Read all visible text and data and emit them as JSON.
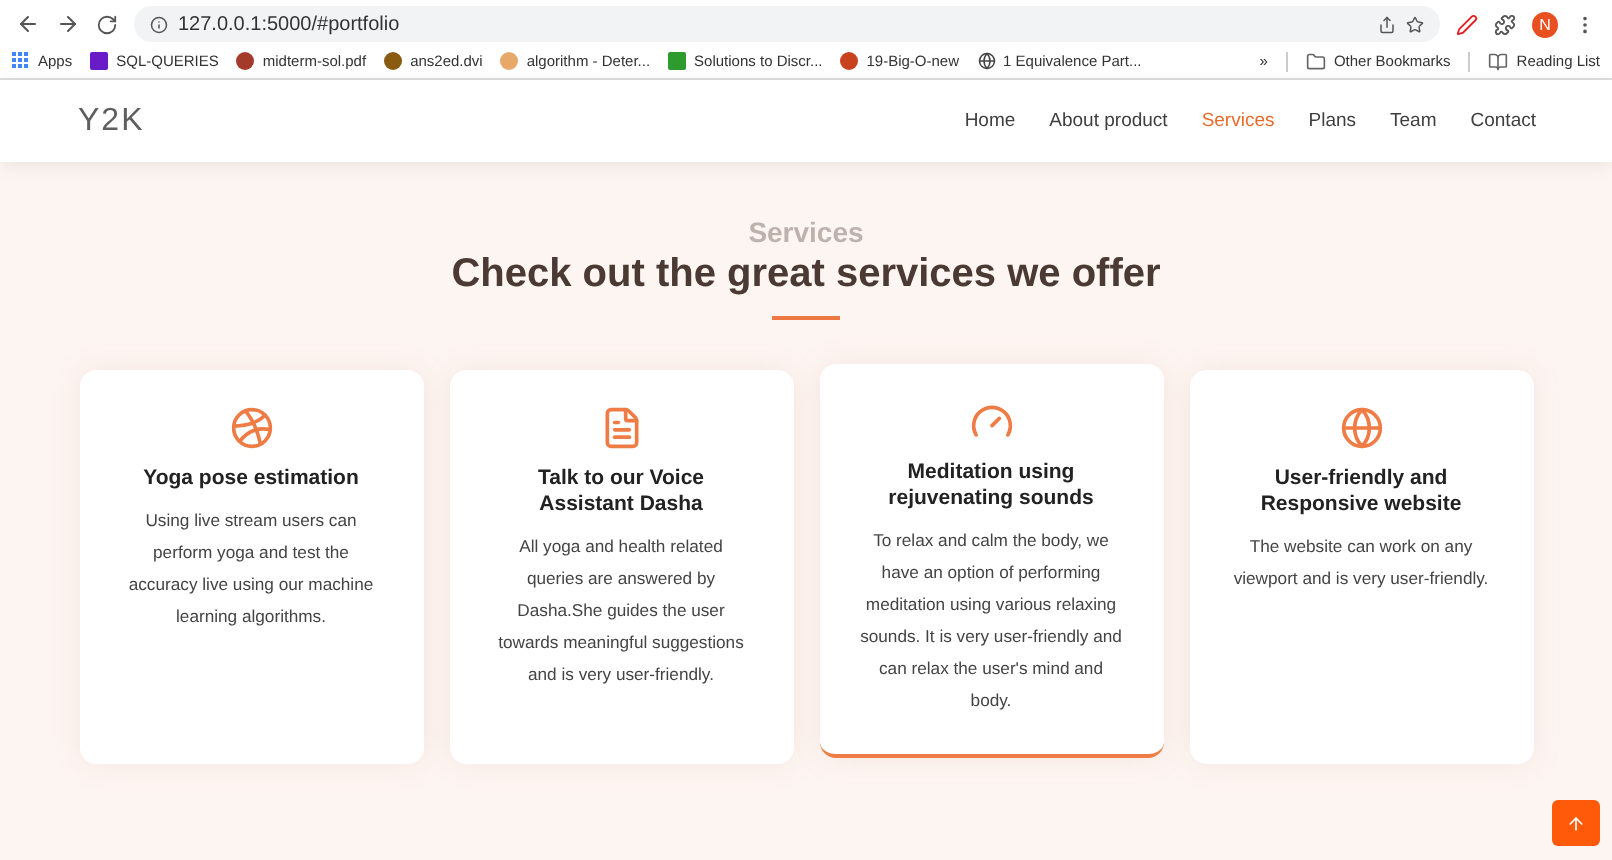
{
  "browser": {
    "url": "127.0.0.1:5000/#portfolio",
    "profile_initial": "N",
    "bookmarks": [
      {
        "label": "Apps",
        "kind": "grid",
        "color": "#4285f4"
      },
      {
        "label": "SQL-QUERIES",
        "kind": "square",
        "color": "#6a1bc8"
      },
      {
        "label": "midterm-sol.pdf",
        "kind": "round",
        "color": "#a33a2a"
      },
      {
        "label": "ans2ed.dvi",
        "kind": "round",
        "color": "#8a5a10"
      },
      {
        "label": "algorithm - Deter...",
        "kind": "round",
        "color": "#e8a86a"
      },
      {
        "label": "Solutions to Discr...",
        "kind": "square",
        "color": "#2e9b2e"
      },
      {
        "label": "19-Big-O-new",
        "kind": "round",
        "color": "#c8421e"
      },
      {
        "label": "1 Equivalence Part...",
        "kind": "globe",
        "color": "#444444"
      }
    ],
    "overflow": "»",
    "other_bookmarks": "Other Bookmarks",
    "reading_list": "Reading List"
  },
  "nav": {
    "logo": "Y2K",
    "links": [
      {
        "label": "Home",
        "selected": false
      },
      {
        "label": "About product",
        "selected": false
      },
      {
        "label": "Services",
        "selected": true
      },
      {
        "label": "Plans",
        "selected": false
      },
      {
        "label": "Team",
        "selected": false
      },
      {
        "label": "Contact",
        "selected": false
      }
    ]
  },
  "section": {
    "eyebrow": "Services",
    "title": "Check out the great services we offer",
    "cards": [
      {
        "kind": "basketball",
        "title": "Yoga pose estimation",
        "text": "Using live stream users can perform yoga and test the accuracy live using our machine learning algorithms.",
        "hovered": false
      },
      {
        "kind": "document",
        "title": "Talk to our Voice Assistant Dasha",
        "text": "All yoga and health related queries are answered by Dasha.She guides the user towards meaningful suggestions and is very user-friendly.",
        "hovered": false
      },
      {
        "kind": "gauge",
        "title": "Meditation using rejuvenating sounds",
        "text": "To relax and calm the body, we have an option of performing meditation using various relaxing sounds. It is very user-friendly and can relax the user's mind and body.",
        "hovered": true
      },
      {
        "kind": "globe",
        "title": "User-friendly and Responsive website",
        "text": "The website can work on any viewport and is very user-friendly.",
        "hovered": false
      }
    ]
  }
}
